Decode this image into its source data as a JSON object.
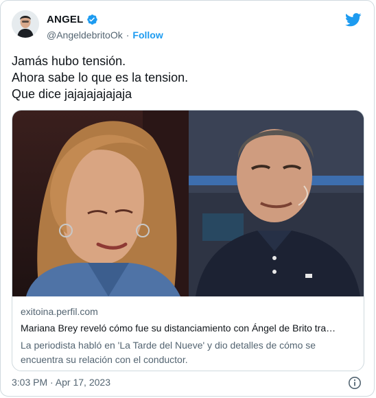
{
  "author": {
    "display_name": "ANGEL",
    "handle": "@AngeldebritoOk",
    "separator": "·",
    "follow_label": "Follow"
  },
  "tweet": {
    "lines": [
      "Jamás hubo tensión.",
      "Ahora sabe lo que es la tension.",
      "Que dice jajajajajajaja"
    ]
  },
  "link_card": {
    "domain": "exitoina.perfil.com",
    "title": "Mariana Brey reveló cómo fue su distanciamiento con Ángel de Brito tra…",
    "description": "La periodista habló en 'La Tarde del Nueve' y dio detalles de cómo se encuentra su relación con el conductor."
  },
  "timestamp": "3:03 PM · Apr 17, 2023",
  "icons": {
    "verified": "verified-badge-icon",
    "brand": "twitter-bird-icon",
    "info": "info-icon"
  },
  "colors": {
    "accent": "#1d9bf0",
    "text": "#0f1419",
    "secondary": "#536471",
    "border": "#cfd9de"
  }
}
